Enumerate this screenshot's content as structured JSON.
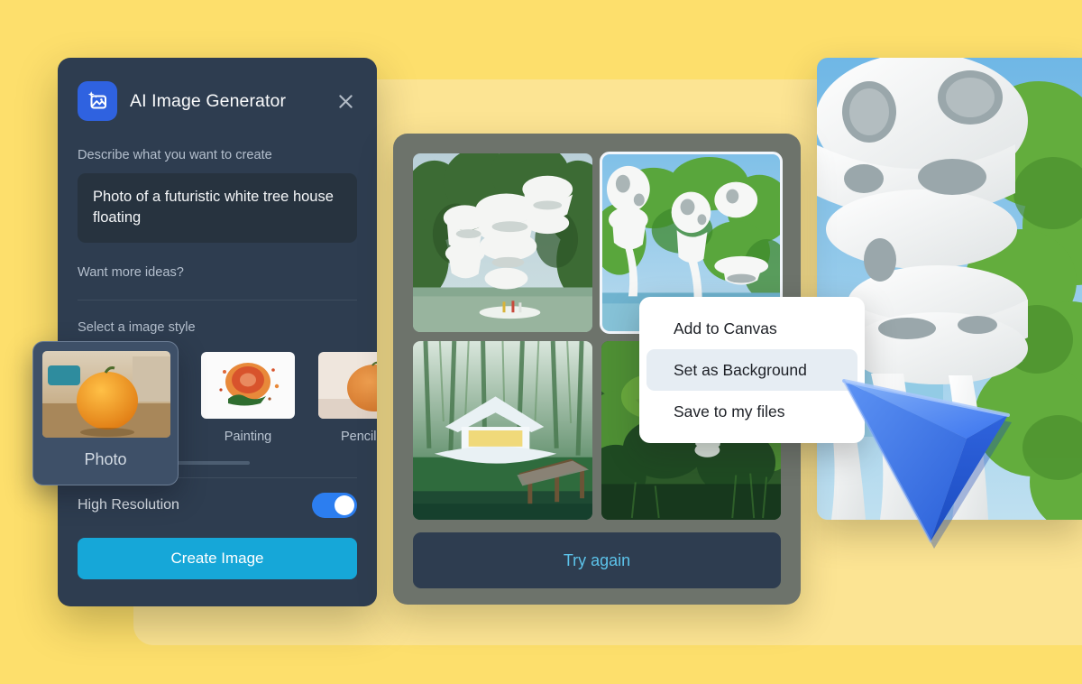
{
  "theme": {
    "page_bg": "#FDDF6C",
    "card_bg": "#FCE493",
    "panel_bg": "#2E3D50",
    "accent_button": "#16A7D8",
    "toggle_on": "#2C7EF0",
    "link_text": "#5CC3EA",
    "cursor_color": "#2D6CF0"
  },
  "generator": {
    "icon": "ai-image-icon",
    "title": "AI Image Generator",
    "close_icon": "close-icon",
    "describe_label": "Describe what you want to create",
    "prompt_value": "Photo of a futuristic white tree house floating",
    "prompt_placeholder": "Describe what you want to create",
    "ideas_label": "Want more ideas?",
    "style_label": "Select a image style",
    "styles": [
      {
        "name": "Photo",
        "selected": true
      },
      {
        "name": "Painting",
        "selected": false
      },
      {
        "name": "Pencil D",
        "selected": false
      }
    ],
    "selected_style": {
      "name": "Photo"
    },
    "high_resolution_label": "High Resolution",
    "high_resolution_on": true,
    "create_label": "Create Image"
  },
  "results": {
    "tiles": [
      {
        "name": "result-1",
        "selected": false
      },
      {
        "name": "result-2",
        "selected": true
      },
      {
        "name": "result-3",
        "selected": false
      },
      {
        "name": "result-4",
        "selected": false
      }
    ],
    "try_again_label": "Try again"
  },
  "context_menu": {
    "items": [
      {
        "label": "Add to Canvas",
        "highlighted": false
      },
      {
        "label": "Set as Background",
        "highlighted": true
      },
      {
        "label": "Save to my files",
        "highlighted": false
      }
    ]
  },
  "preview": {
    "name": "generated-preview-image"
  },
  "cursor": {
    "name": "pointer-cursor"
  }
}
